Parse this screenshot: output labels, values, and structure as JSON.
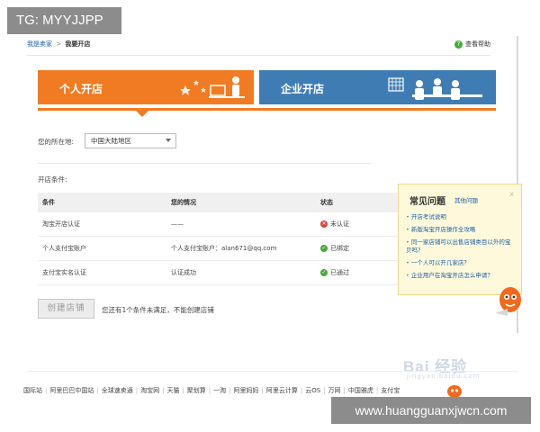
{
  "watermark_top": "TG: MYYJJPP",
  "watermark_url": "www.huangguanxjwcn.com",
  "breadcrumb": {
    "first": "我是卖家",
    "separator": ">",
    "current": "我要开店"
  },
  "help_label": "查看帮助",
  "tabs": [
    {
      "label": "个人开店",
      "color": "#f17b22",
      "active": true
    },
    {
      "label": "企业开店",
      "color": "#3f7cb3",
      "active": false
    }
  ],
  "region": {
    "label": "您的所在地:",
    "selected": "中国大陆地区"
  },
  "conditions": {
    "title": "开店条件:",
    "headers": [
      "条件",
      "您的情况",
      "状态"
    ],
    "rows": [
      {
        "condition": "淘宝开店认证",
        "status_detail": "——",
        "status": "未认证",
        "status_icon": "cross-icon",
        "status_color": "#d9433a"
      },
      {
        "condition": "个人支付宝账户",
        "status_detail": "个人支付宝账户：alan671@qq.com",
        "status": "已绑定",
        "status_icon": "check-icon",
        "status_color": "#4aa83a"
      },
      {
        "condition": "支付宝实名认证",
        "status_detail": "认证成功",
        "status": "已通过",
        "status_icon": "check-icon",
        "status_color": "#4aa83a"
      }
    ]
  },
  "create_button": "创建店铺",
  "create_note": "您还有1个条件未满足，不能创建店铺",
  "faq": {
    "title": "常见问题",
    "more": "其他问题",
    "close": "x",
    "items": [
      "开店考试说明",
      "新版淘宝开店操作全攻略",
      "同一家店铺可以出售店铺类目以外的宝贝吗？",
      "一个人可以开几家店？",
      "企业用户在淘宝开店怎么申请？"
    ]
  },
  "footer_links": [
    "国际站",
    "阿里巴巴中国站",
    "全球速卖通",
    "淘宝网",
    "天猫",
    "聚划算",
    "一淘",
    "阿里妈妈",
    "阿里云计算",
    "云OS",
    "万网",
    "中国雅虎",
    "支付宝"
  ],
  "baidu_watermark": "Bai 经验",
  "baidu_watermark_sub": "jingyan.baidu.com"
}
